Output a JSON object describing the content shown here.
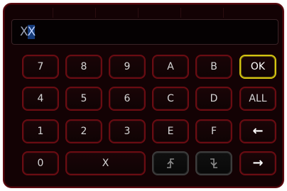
{
  "entry": {
    "value_prefix": "X",
    "value_selected": "X"
  },
  "keys": {
    "row1": [
      "7",
      "8",
      "9",
      "A",
      "B",
      "OK"
    ],
    "row2": [
      "4",
      "5",
      "6",
      "C",
      "D",
      "ALL"
    ],
    "row3": [
      "1",
      "2",
      "3",
      "E",
      "F",
      "←"
    ],
    "row4": [
      "0",
      "X",
      "",
      "",
      "→"
    ]
  },
  "icons": {
    "raise_icon": "raise-edge-icon",
    "fall_icon": "fall-edge-icon"
  },
  "colors": {
    "panel_bg": "#130204",
    "key_border": "#6a0c12",
    "ok_border": "#d4c312",
    "disabled_border": "#3c3c3c",
    "selection": "#153a78"
  }
}
